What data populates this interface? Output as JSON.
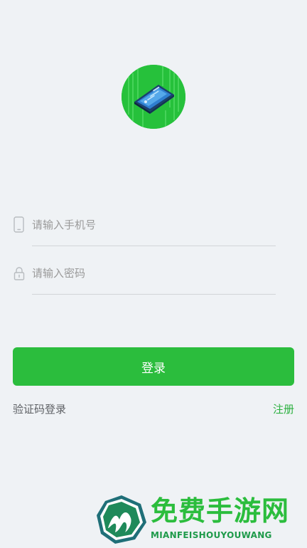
{
  "app": {
    "logo": "app-logo-phone-circuit"
  },
  "form": {
    "phone_placeholder": "请输入手机号",
    "phone_icon": "phone-icon",
    "password_placeholder": "请输入密码",
    "password_icon": "lock-icon",
    "login_label": "登录"
  },
  "links": {
    "sms_login": "验证码登录",
    "register": "注册"
  },
  "watermark": {
    "title": "免费手游网",
    "subtitle": "MIANFEISHOUYOUWANG"
  },
  "colors": {
    "background": "#eff2f5",
    "accent": "#2bbd3d",
    "link_green": "#2bb03f",
    "text_gray": "#5f6266",
    "placeholder": "#9a9a9a"
  }
}
